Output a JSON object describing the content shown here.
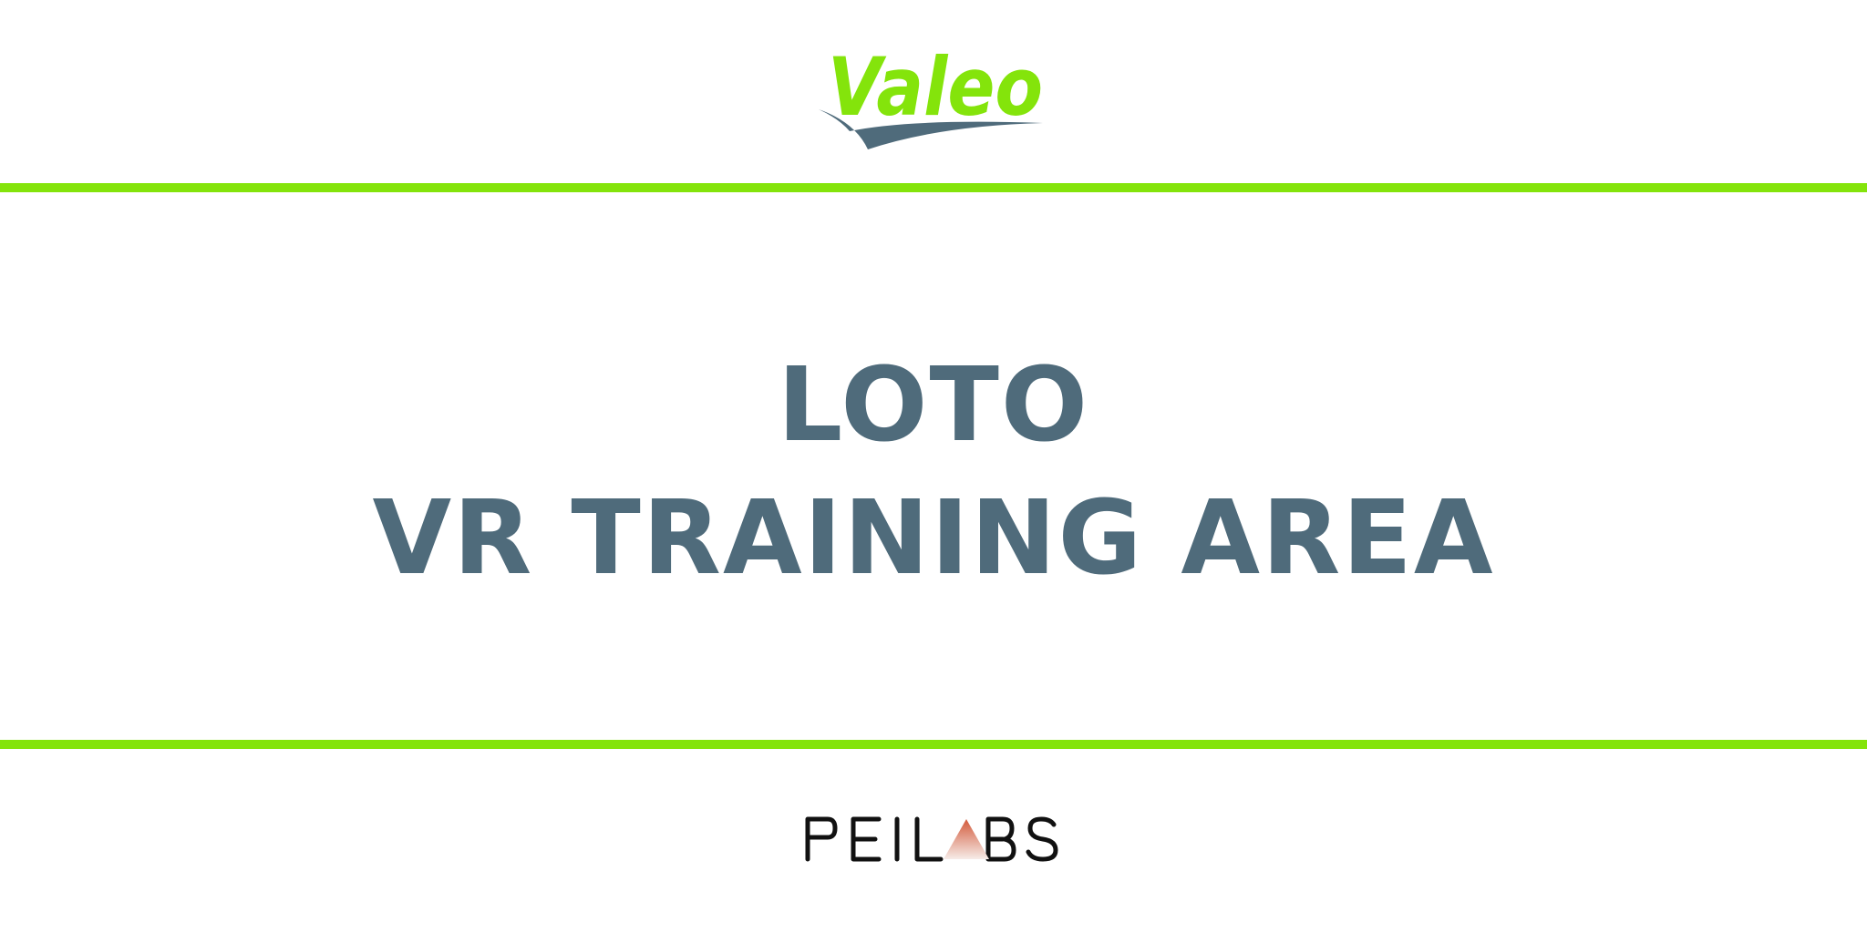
{
  "header": {
    "brand_logo": {
      "text": "Valeo",
      "icon": "valeo-logo",
      "colors": {
        "wordmark": "#84e40b",
        "swoosh": "#4f6b7b"
      }
    }
  },
  "title": {
    "line1": "LOTO",
    "line2": "VR TRAINING AREA",
    "color": "#4f6b7b"
  },
  "accent_color": "#84e40b",
  "footer": {
    "partner_logo": {
      "text": "PEILABS",
      "icon": "peilabs-logo",
      "colors": {
        "letters": "#111111",
        "triangle_top": "#d35a3b",
        "triangle_bottom": "#f3e3de"
      }
    }
  }
}
